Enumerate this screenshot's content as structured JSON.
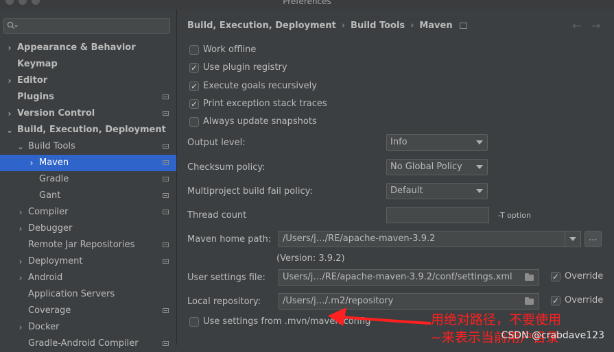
{
  "window": {
    "title": "Preferences"
  },
  "sidebar": {
    "search_placeholder": "",
    "items": [
      {
        "label": "Appearance & Behavior",
        "bold": true,
        "indent": 0,
        "chevron": "›",
        "has_settings_icon": false,
        "selected": false
      },
      {
        "label": "Keymap",
        "bold": true,
        "indent": 0,
        "chevron": "",
        "has_settings_icon": false,
        "selected": false
      },
      {
        "label": "Editor",
        "bold": true,
        "indent": 0,
        "chevron": "›",
        "has_settings_icon": false,
        "selected": false
      },
      {
        "label": "Plugins",
        "bold": true,
        "indent": 0,
        "chevron": "",
        "has_settings_icon": true,
        "selected": false
      },
      {
        "label": "Version Control",
        "bold": true,
        "indent": 0,
        "chevron": "›",
        "has_settings_icon": true,
        "selected": false
      },
      {
        "label": "Build, Execution, Deployment",
        "bold": true,
        "indent": 0,
        "chevron": "⌄",
        "has_settings_icon": false,
        "selected": false
      },
      {
        "label": "Build Tools",
        "bold": false,
        "indent": 1,
        "chevron": "⌄",
        "has_settings_icon": true,
        "selected": false
      },
      {
        "label": "Maven",
        "bold": false,
        "indent": 2,
        "chevron": "›",
        "has_settings_icon": true,
        "selected": true
      },
      {
        "label": "Gradle",
        "bold": false,
        "indent": 2,
        "chevron": "",
        "has_settings_icon": true,
        "selected": false
      },
      {
        "label": "Gant",
        "bold": false,
        "indent": 2,
        "chevron": "",
        "has_settings_icon": true,
        "selected": false
      },
      {
        "label": "Compiler",
        "bold": false,
        "indent": 1,
        "chevron": "›",
        "has_settings_icon": true,
        "selected": false
      },
      {
        "label": "Debugger",
        "bold": false,
        "indent": 1,
        "chevron": "›",
        "has_settings_icon": false,
        "selected": false
      },
      {
        "label": "Remote Jar Repositories",
        "bold": false,
        "indent": 1,
        "chevron": "",
        "has_settings_icon": true,
        "selected": false
      },
      {
        "label": "Deployment",
        "bold": false,
        "indent": 1,
        "chevron": "›",
        "has_settings_icon": true,
        "selected": false
      },
      {
        "label": "Android",
        "bold": false,
        "indent": 1,
        "chevron": "›",
        "has_settings_icon": false,
        "selected": false
      },
      {
        "label": "Application Servers",
        "bold": false,
        "indent": 1,
        "chevron": "",
        "has_settings_icon": false,
        "selected": false
      },
      {
        "label": "Coverage",
        "bold": false,
        "indent": 1,
        "chevron": "",
        "has_settings_icon": true,
        "selected": false
      },
      {
        "label": "Docker",
        "bold": false,
        "indent": 1,
        "chevron": "›",
        "has_settings_icon": false,
        "selected": false
      },
      {
        "label": "Gradle-Android Compiler",
        "bold": false,
        "indent": 1,
        "chevron": "",
        "has_settings_icon": true,
        "selected": false
      }
    ]
  },
  "breadcrumb": {
    "part1": "Build, Execution, Deployment",
    "part2": "Build Tools",
    "part3": "Maven",
    "separator": "›"
  },
  "nav": {
    "back": "←",
    "forward": "→"
  },
  "checkboxes": [
    {
      "label": "Work offline",
      "checked": false
    },
    {
      "label": "Use plugin registry",
      "checked": true
    },
    {
      "label": "Execute goals recursively",
      "checked": true
    },
    {
      "label": "Print exception stack traces",
      "checked": true
    },
    {
      "label": "Always update snapshots",
      "checked": false
    }
  ],
  "fields": {
    "output_level": {
      "label": "Output level:",
      "value": "Info"
    },
    "checksum_policy": {
      "label": "Checksum policy:",
      "value": "No Global Policy"
    },
    "multiproject_fail_policy": {
      "label": "Multiproject build fail policy:",
      "value": "Default"
    },
    "thread_count": {
      "label": "Thread count",
      "value": "",
      "suffix": "-T option"
    },
    "maven_home": {
      "label": "Maven home path:",
      "value": "/Users/j…/RE/apache-maven-3.9.2",
      "browse_label": "...",
      "version": "(Version: 3.9.2)"
    },
    "user_settings": {
      "label": "User settings file:",
      "value": "Users/j…/RE/apache-maven-3.9.2/conf/settings.xml",
      "override_label": "Override",
      "override_checked": true
    },
    "local_repository": {
      "label": "Local repository:",
      "value": "/Users/j…/.m2/repository",
      "override_label": "Override",
      "override_checked": true
    },
    "mvn_settings": {
      "label": "Use settings from .mvn/maven.config",
      "checked": false
    }
  },
  "annotation": {
    "line1": "用绝对路径，不要使用",
    "line2": "~来表示当前用户目录",
    "color": "#ff2020"
  },
  "watermark": "CSDN @crabdave123",
  "colors": {
    "selection": "#2f65ca",
    "background": "#3c3f41",
    "text": "#bbbbbb"
  }
}
